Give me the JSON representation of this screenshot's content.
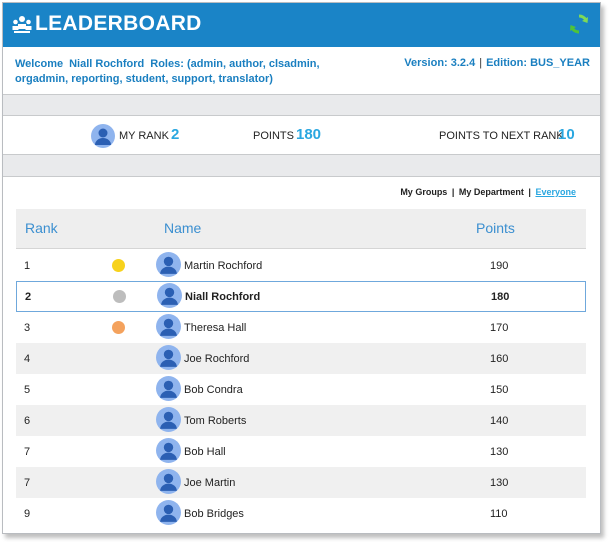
{
  "header": {
    "title": "LEADERBOARD",
    "logo_icon": "leaderboard-people-icon",
    "refresh_icon": "refresh-icon",
    "bg_color": "#1a84c7"
  },
  "user": {
    "welcome_label": "Welcome",
    "name": "Niall Rochford",
    "roles_label": "Roles:",
    "roles": "(admin, author, clsadmin, orgadmin, reporting, student, support, translator)",
    "version": "Version: 3.2.4",
    "separator": "|",
    "edition": "Edition: BUS_YEAR"
  },
  "stats": {
    "my_rank_label": "MY RANK",
    "my_rank": "2",
    "points_label": "POINTS",
    "points": "180",
    "next_label": "POINTS TO NEXT RANK",
    "next": "10"
  },
  "filters": {
    "my_groups": "My Groups",
    "my_department": "My Department",
    "everyone": "Everyone",
    "sep": "|"
  },
  "table": {
    "columns": [
      "Rank",
      "Name",
      "Points"
    ],
    "medal_colors": {
      "gold": "#f7d21c",
      "silver": "#bdbdbd",
      "bronze": "#f4a25d"
    },
    "rows": [
      {
        "rank": "1",
        "name": "Martin Rochford",
        "points": "190",
        "medal": "gold"
      },
      {
        "rank": "2",
        "name": "Niall Rochford",
        "points": "180",
        "medal": "silver",
        "current_user": true
      },
      {
        "rank": "3",
        "name": "Theresa Hall",
        "points": "170",
        "medal": "bronze"
      },
      {
        "rank": "4",
        "name": "Joe Rochford",
        "points": "160"
      },
      {
        "rank": "5",
        "name": "Bob Condra",
        "points": "150"
      },
      {
        "rank": "6",
        "name": "Tom Roberts",
        "points": "140"
      },
      {
        "rank": "7",
        "name": "Bob Hall",
        "points": "130"
      },
      {
        "rank": "7",
        "name": "Joe Martin",
        "points": "130"
      },
      {
        "rank": "9",
        "name": "Bob Bridges",
        "points": "110"
      }
    ]
  }
}
